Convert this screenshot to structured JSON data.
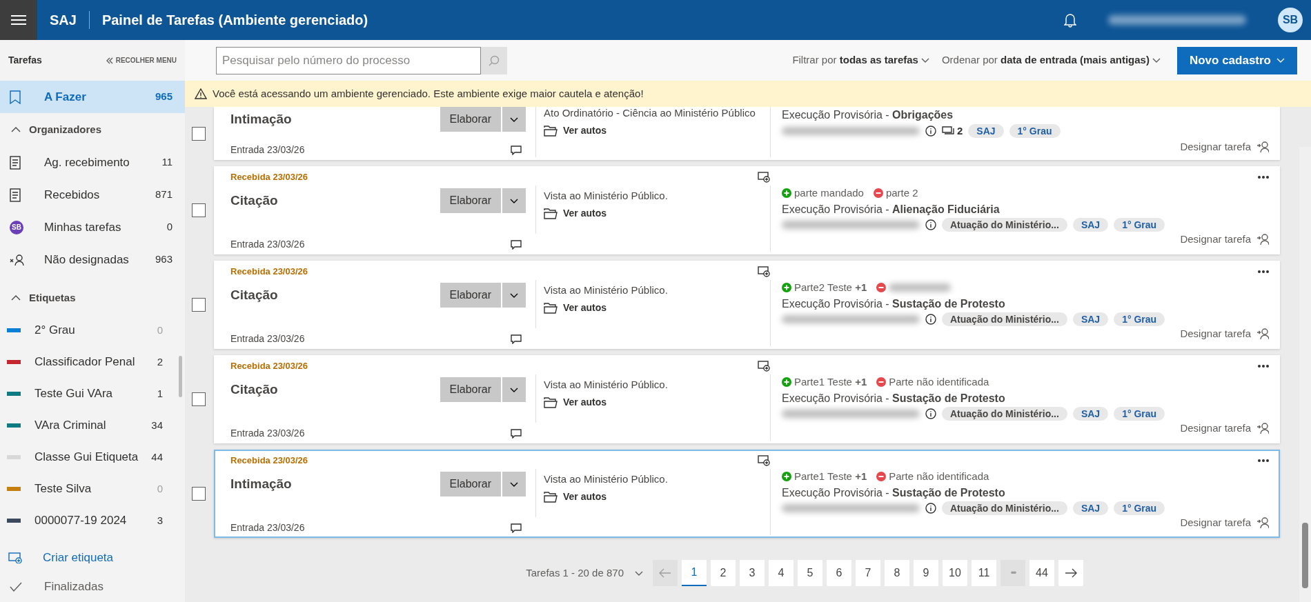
{
  "header": {
    "brand": "SAJ",
    "title": "Painel de Tarefas (Ambiente gerenciado)",
    "avatar": "SB"
  },
  "sidebar": {
    "title": "Tarefas",
    "collapse": "RECOLHER MENU",
    "main": {
      "label": "A Fazer",
      "count": "965",
      "selected": true
    },
    "sections": [
      {
        "title": "Organizadores",
        "expanded": true,
        "items": [
          {
            "kind": "document",
            "label": "Ag. recebimento",
            "count": "11",
            "selected": false
          },
          {
            "kind": "document",
            "label": "Recebidos",
            "count": "871",
            "selected": false
          },
          {
            "kind": "avatar",
            "avatar": "SB",
            "label": "Minhas tarefas",
            "count": "0",
            "selected": false
          },
          {
            "kind": "unassigned",
            "label": "Não designadas",
            "count": "963",
            "selected": false
          }
        ]
      },
      {
        "title": "Etiquetas",
        "expanded": true,
        "items": [
          {
            "kind": "tag",
            "color": "#0a7fd6",
            "label": "2° Grau",
            "count": "0",
            "empty": true,
            "selected": false
          },
          {
            "kind": "tag",
            "color": "#c4262e",
            "label": "Classificador Penal",
            "count": "2",
            "empty": false,
            "selected": false
          },
          {
            "kind": "tag",
            "color": "#0e7a82",
            "label": "Teste Gui VAra",
            "count": "1",
            "empty": false,
            "selected": false
          },
          {
            "kind": "tag",
            "color": "#0e7a82",
            "label": "VAra Criminal",
            "count": "34",
            "empty": false,
            "selected": false
          },
          {
            "kind": "tag",
            "color": "#d8d8d8",
            "label": "Classe Gui Etiqueta",
            "count": "44",
            "empty": false,
            "selected": false
          },
          {
            "kind": "tag",
            "color": "#c57f0e",
            "label": "Teste Silva",
            "count": "0",
            "empty": true,
            "selected": false
          },
          {
            "kind": "tag",
            "color": "#3a4a5c",
            "label": "0000077-19 2024",
            "count": "3",
            "empty": false,
            "selected": false
          }
        ]
      }
    ],
    "create_label": "Criar etiqueta",
    "finished": "Finalizadas"
  },
  "toolbar": {
    "search": {
      "placeholder": "Pesquisar pelo número do processo"
    },
    "filter": "Filtrar por **todas as tarefas**",
    "sort": "Ordenar por **data de entrada (mais antigas)**",
    "new_button": "Novo cadastro"
  },
  "banner": "Você está acessando um ambiente gerenciado. Este ambiente exige maior cautela e atenção!",
  "tasks": [
    {
      "checked": false,
      "title": "Intimação",
      "action": "Elaborar",
      "entry": "Entrada 23/03/26",
      "description": "Ato Ordinatório - Ciência ao Ministério Público",
      "link": "Ver autos",
      "class": "Execução Provisória - **Obrigações**",
      "comments": "2",
      "tags": [
        "SAJ",
        "1° Grau"
      ],
      "assign": "Designar tarefa",
      "selected": false
    },
    {
      "checked": false,
      "received": "Recebida 23/03/26",
      "title": "Citação",
      "action": "Elaborar",
      "entry": "Entrada 23/03/26",
      "description": "Vista ao Ministério Público.",
      "link": "Ver autos",
      "parties": [
        {
          "kind": "active",
          "name": "parte mandado"
        },
        {
          "kind": "passive",
          "name": "parte 2"
        }
      ],
      "class": "Execução Provisória - **Alienação Fiduciária**",
      "tags": [
        "Atuação do Ministério...",
        "SAJ",
        "1° Grau"
      ],
      "assign": "Designar tarefa",
      "selected": false
    },
    {
      "checked": false,
      "received": "Recebida 23/03/26",
      "title": "Citação",
      "action": "Elaborar",
      "entry": "Entrada 23/03/26",
      "description": "Vista ao Ministério Público.",
      "link": "Ver autos",
      "parties": [
        {
          "kind": "active",
          "name": "Parte2 Teste **+1**"
        },
        {
          "kind": "passive",
          "blurred": true
        }
      ],
      "class": "Execução Provisória - **Sustação de Protesto**",
      "tags": [
        "Atuação do Ministério...",
        "SAJ",
        "1° Grau"
      ],
      "assign": "Designar tarefa",
      "selected": false
    },
    {
      "checked": false,
      "received": "Recebida 23/03/26",
      "title": "Citação",
      "action": "Elaborar",
      "entry": "Entrada 23/03/26",
      "description": "Vista ao Ministério Público.",
      "link": "Ver autos",
      "parties": [
        {
          "kind": "active",
          "name": "Parte1 Teste **+1**"
        },
        {
          "kind": "passive",
          "name": "Parte não identificada"
        }
      ],
      "class": "Execução Provisória - **Sustação de Protesto**",
      "tags": [
        "Atuação do Ministério...",
        "SAJ",
        "1° Grau"
      ],
      "assign": "Designar tarefa",
      "selected": false
    },
    {
      "checked": false,
      "received": "Recebida 23/03/26",
      "title": "Intimação",
      "action": "Elaborar",
      "entry": "Entrada 23/03/26",
      "description": "Vista ao Ministério Público.",
      "link": "Ver autos",
      "parties": [
        {
          "kind": "active",
          "name": "Parte1 Teste **+1**"
        },
        {
          "kind": "passive",
          "name": "Parte não identificada"
        }
      ],
      "class": "Execução Provisória - **Sustação de Protesto**",
      "tags": [
        "Atuação do Ministério...",
        "SAJ",
        "1° Grau"
      ],
      "assign": "Designar tarefa",
      "selected": true
    }
  ],
  "pagination": {
    "summary": "Tarefas 1 - 20 de 870",
    "previous": {
      "disabled": true
    },
    "next": {
      "disabled": false
    },
    "pages": [
      {
        "kind": "page",
        "label": "1",
        "selected": true
      },
      {
        "kind": "page",
        "label": "2",
        "selected": false
      },
      {
        "kind": "page",
        "label": "3",
        "selected": false
      },
      {
        "kind": "page",
        "label": "4",
        "selected": false
      },
      {
        "kind": "page",
        "label": "5",
        "selected": false
      },
      {
        "kind": "page",
        "label": "6",
        "selected": false
      },
      {
        "kind": "page",
        "label": "7",
        "selected": false
      },
      {
        "kind": "page",
        "label": "8",
        "selected": false
      },
      {
        "kind": "page",
        "label": "9",
        "selected": false
      },
      {
        "kind": "page",
        "label": "10",
        "selected": false
      },
      {
        "kind": "page",
        "label": "11",
        "selected": false
      },
      {
        "kind": "ellipsis",
        "label": "•••",
        "selected": false
      },
      {
        "kind": "page",
        "label": "44",
        "selected": false
      }
    ]
  }
}
